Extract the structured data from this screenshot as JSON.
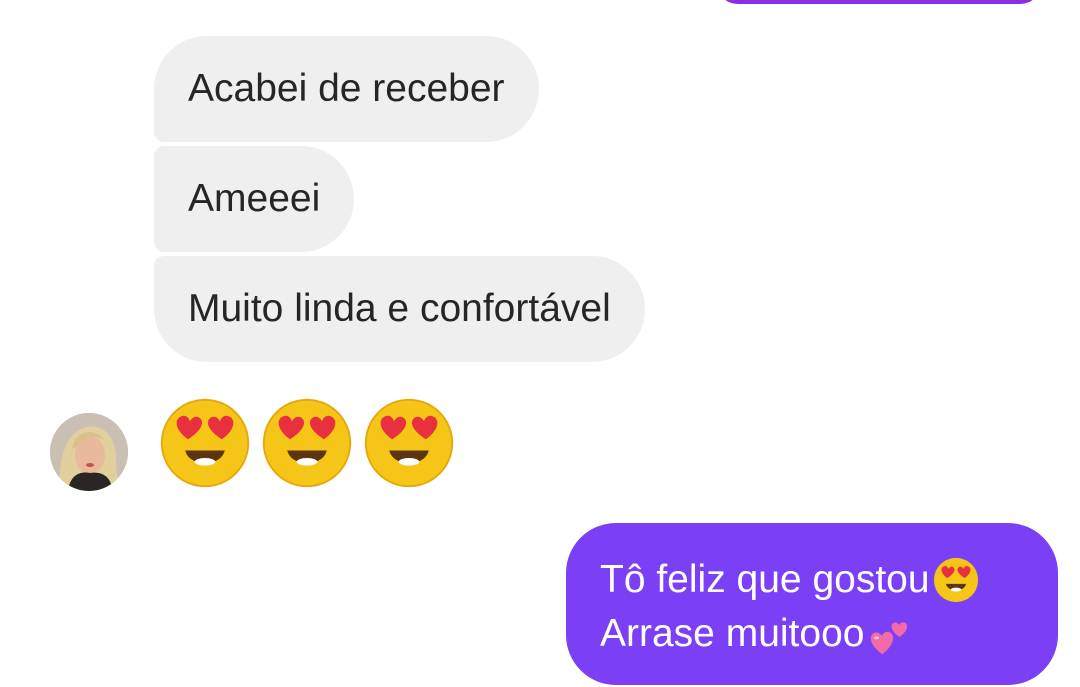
{
  "thread": {
    "previous_outgoing_partial": true,
    "incoming_messages": [
      "Acabei de receber",
      "Ameeei",
      "Muito linda e confortável"
    ],
    "incoming_reaction": {
      "emojis": [
        "heart-eyes-emoji",
        "heart-eyes-emoji",
        "heart-eyes-emoji"
      ]
    },
    "outgoing_message": {
      "line1_text": "Tô feliz que gostou",
      "line1_emoji": "heart-eyes-emoji",
      "line2_text": "Arrase muitooo ",
      "line2_emoji": "two-hearts-emoji"
    }
  },
  "colors": {
    "incoming_bubble": "#efefef",
    "incoming_text": "#262626",
    "outgoing_bubble": "#7b3ff5",
    "outgoing_text": "#ffffff",
    "previous_bubble": "#8a2fe6"
  }
}
